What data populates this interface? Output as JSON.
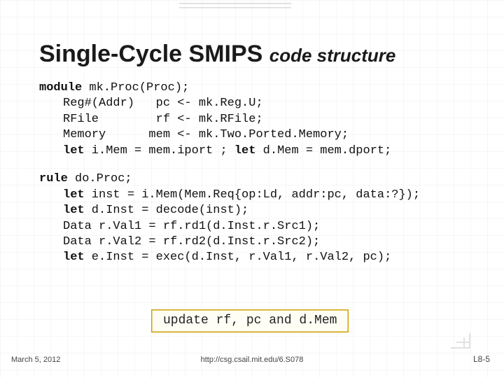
{
  "title": {
    "main": "Single-Cycle SMIPS ",
    "sub": "code structure"
  },
  "code_block1": {
    "l1a": "module",
    "l1b": " mk.Proc(Proc);",
    "l2": "Reg#(Addr)   pc <- mk.Reg.U;",
    "l3": "RFile        rf <- mk.RFile;",
    "l4": "Memory      mem <- mk.Two.Ported.Memory;",
    "l5a": "let",
    "l5b": " i.Mem = mem.iport ; ",
    "l5c": "let",
    "l5d": " d.Mem = mem.dport;"
  },
  "code_block2": {
    "l1a": "rule",
    "l1b": " do.Proc;",
    "l2a": "let",
    "l2b": " inst = i.Mem(Mem.Req{op:Ld, addr:pc, data:?});",
    "l3a": "let",
    "l3b": " d.Inst = decode(inst);",
    "l4": "Data r.Val1 = rf.rd1(d.Inst.r.Src1);",
    "l5": "Data r.Val2 = rf.rd2(d.Inst.r.Src2);",
    "l6a": "let",
    "l6b": " e.Inst = exec(d.Inst, r.Val1, r.Val2, pc);"
  },
  "note": "update rf, pc and d.Mem",
  "footer": {
    "date": "March 5, 2012",
    "url": "http://csg.csail.mit.edu/6.S078",
    "page": "L8-5"
  }
}
